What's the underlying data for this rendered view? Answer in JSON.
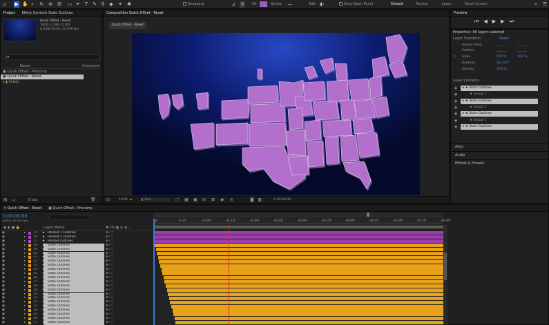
{
  "toolbar": {
    "snapping_label": "Snapping",
    "fill_label": "Fill",
    "stroke_label": "Stroke",
    "add_label": "Add",
    "auto_open_label": "Auto-Open Panel",
    "workspaces": [
      "Default",
      "Review",
      "Learn",
      "Small Screen"
    ],
    "fill_color": "#9b5fc0"
  },
  "project": {
    "panel_tab": "Project",
    "effect_tab": "Effect Controls State Outlines",
    "item_title": "Quick Offset - Reset",
    "item_info_1": "1920 x 1080 (1.00)",
    "item_info_2": "Δ 0;00;10;00, 23.976 fps",
    "search_placeholder": "ρ▾",
    "col_name": "Name",
    "col_comment": "Comment",
    "items": [
      "Quick Offset - Precomp",
      "Quick Offset - Reset",
      "Solids"
    ]
  },
  "composition": {
    "tab": "Composition Quick Offset - Reset",
    "sub_tab": "Quick Offset - Reset",
    "zoom": "100%",
    "resolution": "Full",
    "timecode": "0;00;00;00"
  },
  "timeline": {
    "tab_active": "Quick Offset - Reset",
    "tab_other": "Quick Offset - Precomp",
    "timecode": "0;00;00;00",
    "frames": "00000 (23.976 fps)",
    "col_layer_name": "Layer Name",
    "bpc": "8 bpc",
    "ruler": [
      "0s",
      "0:12f",
      "01:00f",
      "01:12f",
      "02:00f",
      "02:12f",
      "03:00f",
      "03:12f",
      "04:00f",
      "04:12f",
      "05:00f",
      "05:12f",
      "06:00f"
    ],
    "layers": [
      {
        "num": "15",
        "name": "Polimet 1 Outlines",
        "color": "#b24bc6",
        "kind": "purple",
        "selected": false
      },
      {
        "num": "16",
        "name": "Polimet 2 Outlines",
        "color": "#b24bc6",
        "kind": "purple",
        "selected": false
      },
      {
        "num": "17",
        "name": "Polimet Outlines",
        "color": "#b24bc6",
        "kind": "purple",
        "selected": false
      },
      {
        "num": "18",
        "name": "State Outlines",
        "color": "#e8a21a",
        "kind": "orange",
        "selected": true
      },
      {
        "num": "19",
        "name": "State Outlines",
        "color": "#e8a21a",
        "kind": "orange",
        "selected": true
      },
      {
        "num": "20",
        "name": "State Outlines",
        "color": "#e8a21a",
        "kind": "orange",
        "selected": true
      },
      {
        "num": "21",
        "name": "State Outlines",
        "color": "#e8a21a",
        "kind": "orange",
        "selected": true
      },
      {
        "num": "22",
        "name": "State Outlines",
        "color": "#e8a21a",
        "kind": "orange",
        "selected": true
      },
      {
        "num": "23",
        "name": "State Outlines",
        "color": "#e8a21a",
        "kind": "orange",
        "selected": true
      },
      {
        "num": "24",
        "name": "State Outlines",
        "color": "#e8a21a",
        "kind": "orange",
        "selected": true
      },
      {
        "num": "25",
        "name": "State Outlines",
        "color": "#e8a21a",
        "kind": "orange",
        "selected": true
      },
      {
        "num": "26",
        "name": "State Outlines",
        "color": "#e8a21a",
        "kind": "orange",
        "selected": true
      },
      {
        "num": "27",
        "name": "State Outlines",
        "color": "#e8a21a",
        "kind": "orange",
        "selected": true
      },
      {
        "num": "28",
        "name": "State Outlines",
        "color": "#e8a21a",
        "kind": "orange",
        "selected": true
      },
      {
        "num": "29",
        "name": "State Outlines",
        "color": "#e8a21a",
        "kind": "orange",
        "selected": true
      },
      {
        "num": "30",
        "name": "State Outlines",
        "color": "#e8a21a",
        "kind": "orange",
        "selected": true
      },
      {
        "num": "31",
        "name": "State Outlines",
        "color": "#e8a21a",
        "kind": "orange",
        "selected": true
      },
      {
        "num": "32",
        "name": "State Outlines",
        "color": "#e8a21a",
        "kind": "orange",
        "selected": true
      },
      {
        "num": "33",
        "name": "State Outlines",
        "color": "#e8a21a",
        "kind": "orange",
        "selected": true
      },
      {
        "num": "34",
        "name": "State Outlines",
        "color": "#e8a21a",
        "kind": "orange",
        "selected": true
      },
      {
        "num": "35",
        "name": "State Outlines",
        "color": "#e8a21a",
        "kind": "orange",
        "selected": true
      },
      {
        "num": "36",
        "name": "State Outlines",
        "color": "#e8a21a",
        "kind": "orange",
        "selected": true
      },
      {
        "num": "37",
        "name": "State Outlines",
        "color": "#e8a21a",
        "kind": "orange",
        "selected": true
      }
    ]
  },
  "preview": {
    "tab": "Preview"
  },
  "properties": {
    "title": "Properties: 50 layers selected",
    "layer_transform": "Layer Transform",
    "reset": "Reset",
    "anchor_point": "Anchor Point",
    "position": "Position",
    "scale": "Scale",
    "scale_value": "100 %",
    "scale_value2": "100 %",
    "rotation": "Rotation",
    "rotation_value": "0x+0.0°",
    "opacity": "Opacity",
    "opacity_value": "100 %",
    "layer_contents": "Layer Contents",
    "contents": [
      {
        "label": "State Outlines",
        "kind": "layer"
      },
      {
        "label": "Group 1",
        "kind": "group"
      },
      {
        "label": "State Outlines",
        "kind": "layer"
      },
      {
        "label": "Group 1",
        "kind": "group"
      },
      {
        "label": "State Outlines",
        "kind": "layer"
      },
      {
        "label": "Group 1",
        "kind": "group"
      },
      {
        "label": "State Outlines",
        "kind": "layer"
      }
    ],
    "sections": [
      "Align",
      "Audio",
      "Effects & Presets"
    ]
  }
}
